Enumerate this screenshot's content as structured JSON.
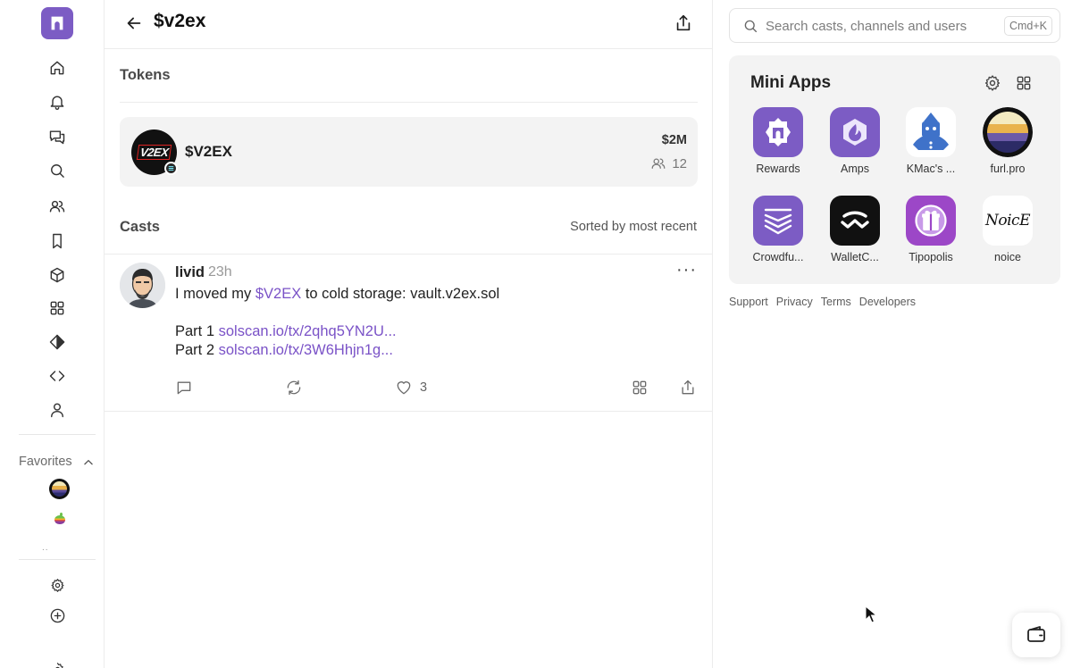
{
  "header": {
    "title": "$v2ex"
  },
  "tokens": {
    "section_title": "Tokens",
    "items": [
      {
        "avatar_text": "V2EX",
        "name": "$V2EX",
        "market_cap": "$2M",
        "holders": "12"
      }
    ]
  },
  "casts": {
    "section_title": "Casts",
    "sort_label": "Sorted by most recent",
    "items": [
      {
        "username": "livid",
        "time": "23h",
        "text_before": "I moved my ",
        "mention": "$V2EX",
        "text_after": " to cold storage: vault.v2ex.sol",
        "part1_label": "Part 1 ",
        "part1_link": "solscan.io/tx/2qhq5YN2U...",
        "part2_label": "Part 2 ",
        "part2_link": "solscan.io/tx/3W6Hhjn1g...",
        "likes": "3",
        "more": "···"
      }
    ]
  },
  "search": {
    "placeholder": "Search casts, channels and users",
    "shortcut": "Cmd+K"
  },
  "mini_apps": {
    "title": "Mini Apps",
    "apps": [
      {
        "name": "Rewards",
        "icon": "rewards-icon",
        "color": "#7c5cc4"
      },
      {
        "name": "Amps",
        "icon": "amps-icon",
        "color": "#7c5cc4"
      },
      {
        "name": "KMac's ...",
        "icon": "kmac-icon",
        "color": "#3f72c9"
      },
      {
        "name": "furl.pro",
        "icon": "furl-icon",
        "color": "#111111"
      },
      {
        "name": "Crowdfu...",
        "icon": "crowdfund-icon",
        "color": "#7c5cc4"
      },
      {
        "name": "WalletC...",
        "icon": "walletconnect-icon",
        "color": "#111111"
      },
      {
        "name": "Tipopolis",
        "icon": "tipopolis-icon",
        "color": "#9c47c7"
      },
      {
        "name": "noice",
        "icon": "noice-icon",
        "color": "#ffffff",
        "glyph": "NoicE"
      }
    ]
  },
  "sidebar": {
    "favorites_label": "Favorites",
    "more_indicator": "..",
    "nav": [
      "home-icon",
      "bell-icon",
      "chat-icon",
      "search-icon",
      "users-icon",
      "bookmark-icon",
      "cube-icon",
      "grid-icon",
      "diamond-icon",
      "code-icon",
      "profile-icon"
    ]
  },
  "footer": {
    "links": [
      "Support",
      "Privacy",
      "Terms",
      "Developers"
    ]
  },
  "colors": {
    "brand": "#7c5cc4",
    "link": "#7a52c7",
    "card_bg": "#f3f3f3"
  }
}
